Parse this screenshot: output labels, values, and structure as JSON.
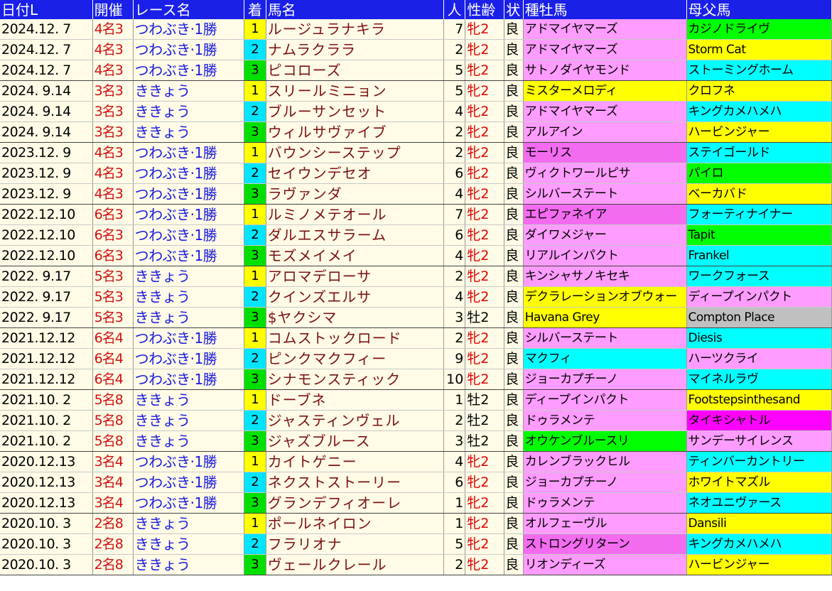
{
  "headers": [
    "日付L",
    "開催",
    "レース名",
    "着",
    "馬名",
    "人",
    "性齢",
    "状",
    "種牡馬",
    "母父馬"
  ],
  "colors": {
    "header_bg": "#1a20e8",
    "cell_bg": "#fffbe6",
    "pos1": "#ffff00",
    "pos2": "#00e5ff",
    "pos3": "#00e000",
    "pink": "#ff9cff",
    "cyan": "#00ffff",
    "yellow": "#ffff00",
    "green": "#00ff00",
    "magenta": "#ff00ff",
    "gray": "#c0c0c0"
  },
  "rows": [
    {
      "date": "2024.12. 7",
      "kai": "4名3",
      "race": "つわぶき·1勝",
      "pos": "1",
      "horse": "ルージュラナキラ",
      "pop": "7",
      "sex": "牝2",
      "cond": "良",
      "sire": "アドマイヤマーズ",
      "sire_color": "pink",
      "bms": "カジノドライヴ",
      "bms_color": "green"
    },
    {
      "date": "2024.12. 7",
      "kai": "4名3",
      "race": "つわぶき·1勝",
      "pos": "2",
      "horse": "ナムラクララ",
      "pop": "2",
      "sex": "牝2",
      "cond": "良",
      "sire": "アドマイヤマーズ",
      "sire_color": "pink",
      "bms": "Storm Cat",
      "bms_color": "yellow"
    },
    {
      "date": "2024.12. 7",
      "kai": "4名3",
      "race": "つわぶき·1勝",
      "pos": "3",
      "horse": "ピコローズ",
      "pop": "5",
      "sex": "牝2",
      "cond": "良",
      "sire": "サトノダイヤモンド",
      "sire_color": "pink",
      "bms": "ストーミングホーム",
      "bms_color": "cyan"
    },
    {
      "date": "2024. 9.14",
      "kai": "3名3",
      "race": "ききょう",
      "pos": "1",
      "horse": "スリールミニョン",
      "pop": "5",
      "sex": "牝2",
      "cond": "良",
      "sire": "ミスターメロディ",
      "sire_color": "yellow",
      "bms": "クロフネ",
      "bms_color": "yellow"
    },
    {
      "date": "2024. 9.14",
      "kai": "3名3",
      "race": "ききょう",
      "pos": "2",
      "horse": "ブルーサンセット",
      "pop": "4",
      "sex": "牝2",
      "cond": "良",
      "sire": "アドマイヤマーズ",
      "sire_color": "pink",
      "bms": "キングカメハメハ",
      "bms_color": "cyan"
    },
    {
      "date": "2024. 9.14",
      "kai": "3名3",
      "race": "ききょう",
      "pos": "3",
      "horse": "ウィルサヴァイブ",
      "pop": "2",
      "sex": "牝2",
      "cond": "良",
      "sire": "アルアイン",
      "sire_color": "pink",
      "bms": "ハービンジャー",
      "bms_color": "yellow"
    },
    {
      "date": "2023.12. 9",
      "kai": "4名3",
      "race": "つわぶき·1勝",
      "pos": "1",
      "horse": "バウンシーステップ",
      "pop": "2",
      "sex": "牝2",
      "cond": "良",
      "sire": "モーリス",
      "sire_color": "magenta_soft",
      "bms": "ステイゴールド",
      "bms_color": "cyan"
    },
    {
      "date": "2023.12. 9",
      "kai": "4名3",
      "race": "つわぶき·1勝",
      "pos": "2",
      "horse": "セイウンデセオ",
      "pop": "6",
      "sex": "牝2",
      "cond": "良",
      "sire": "ヴィクトワールピサ",
      "sire_color": "pink",
      "bms": "パイロ",
      "bms_color": "green"
    },
    {
      "date": "2023.12. 9",
      "kai": "4名3",
      "race": "つわぶき·1勝",
      "pos": "3",
      "horse": "ラヴァンダ",
      "pop": "4",
      "sex": "牝2",
      "cond": "良",
      "sire": "シルバーステート",
      "sire_color": "pink",
      "bms": "ベーカバド",
      "bms_color": "yellow"
    },
    {
      "date": "2022.12.10",
      "kai": "6名3",
      "race": "つわぶき·1勝",
      "pos": "1",
      "horse": "ルミノメテオール",
      "pop": "7",
      "sex": "牝2",
      "cond": "良",
      "sire": "エピファネイア",
      "sire_color": "magenta_soft",
      "bms": "フォーティナイナー",
      "bms_color": "cyan"
    },
    {
      "date": "2022.12.10",
      "kai": "6名3",
      "race": "つわぶき·1勝",
      "pos": "2",
      "horse": "ダルエスサラーム",
      "pop": "6",
      "sex": "牝2",
      "cond": "良",
      "sire": "ダイワメジャー",
      "sire_color": "pink",
      "bms": "Tapit",
      "bms_color": "green"
    },
    {
      "date": "2022.12.10",
      "kai": "6名3",
      "race": "つわぶき·1勝",
      "pos": "3",
      "horse": "モズメイメイ",
      "pop": "4",
      "sex": "牝2",
      "cond": "良",
      "sire": "リアルインパクト",
      "sire_color": "pink",
      "bms": "Frankel",
      "bms_color": "cyan"
    },
    {
      "date": "2022. 9.17",
      "kai": "5名3",
      "race": "ききょう",
      "pos": "1",
      "horse": "アロマデローサ",
      "pop": "2",
      "sex": "牝2",
      "cond": "良",
      "sire": "キンシャサノキセキ",
      "sire_color": "pink",
      "bms": "ワークフォース",
      "bms_color": "cyan"
    },
    {
      "date": "2022. 9.17",
      "kai": "5名3",
      "race": "ききょう",
      "pos": "2",
      "horse": "クインズエルサ",
      "pop": "4",
      "sex": "牝2",
      "cond": "良",
      "sire": "デクラレーションオブウォー",
      "sire_color": "yellow",
      "bms": "ディープインパクト",
      "bms_color": "pink"
    },
    {
      "date": "2022. 9.17",
      "kai": "5名3",
      "race": "ききょう",
      "pos": "3",
      "horse": "$ヤクシマ",
      "pop": "3",
      "sex": "牡2",
      "cond": "良",
      "sire": "Havana Grey",
      "sire_color": "yellow",
      "bms": "Compton Place",
      "bms_color": "gray"
    },
    {
      "date": "2021.12.12",
      "kai": "6名4",
      "race": "つわぶき·1勝",
      "pos": "1",
      "horse": "コムストックロード",
      "pop": "2",
      "sex": "牝2",
      "cond": "良",
      "sire": "シルバーステート",
      "sire_color": "pink",
      "bms": "Diesis",
      "bms_color": "cyan"
    },
    {
      "date": "2021.12.12",
      "kai": "6名4",
      "race": "つわぶき·1勝",
      "pos": "2",
      "horse": "ピンクマクフィー",
      "pop": "9",
      "sex": "牝2",
      "cond": "良",
      "sire": "マクフィ",
      "sire_color": "cyan",
      "bms": "ハーツクライ",
      "bms_color": "pink"
    },
    {
      "date": "2021.12.12",
      "kai": "6名4",
      "race": "つわぶき·1勝",
      "pos": "3",
      "horse": "シナモンスティック",
      "pop": "10",
      "sex": "牝2",
      "cond": "良",
      "sire": "ジョーカプチーノ",
      "sire_color": "pink",
      "bms": "マイネルラヴ",
      "bms_color": "cyan"
    },
    {
      "date": "2021.10. 2",
      "kai": "5名8",
      "race": "ききょう",
      "pos": "1",
      "horse": "ドーブネ",
      "pop": "1",
      "sex": "牡2",
      "cond": "良",
      "sire": "ディープインパクト",
      "sire_color": "pink",
      "bms": "Footstepsinthesand",
      "bms_color": "yellow"
    },
    {
      "date": "2021.10. 2",
      "kai": "5名8",
      "race": "ききょう",
      "pos": "2",
      "horse": "ジャスティンヴェル",
      "pop": "2",
      "sex": "牡2",
      "cond": "良",
      "sire": "ドゥラメンテ",
      "sire_color": "pink",
      "bms": "タイキシャトル",
      "bms_color": "magenta"
    },
    {
      "date": "2021.10. 2",
      "kai": "5名8",
      "race": "ききょう",
      "pos": "3",
      "horse": "ジャズブルース",
      "pop": "3",
      "sex": "牡2",
      "cond": "良",
      "sire": "オウケンブルースリ",
      "sire_color": "green",
      "bms": "サンデーサイレンス",
      "bms_color": "pink"
    },
    {
      "date": "2020.12.13",
      "kai": "3名4",
      "race": "つわぶき·1勝",
      "pos": "1",
      "horse": "カイトゲニー",
      "pop": "4",
      "sex": "牝2",
      "cond": "良",
      "sire": "カレンブラックヒル",
      "sire_color": "pink",
      "bms": "ティンバーカントリー",
      "bms_color": "cyan"
    },
    {
      "date": "2020.12.13",
      "kai": "3名4",
      "race": "つわぶき·1勝",
      "pos": "2",
      "horse": "ネクストストーリー",
      "pop": "6",
      "sex": "牝2",
      "cond": "良",
      "sire": "ジョーカプチーノ",
      "sire_color": "pink",
      "bms": "ホワイトマズル",
      "bms_color": "yellow"
    },
    {
      "date": "2020.12.13",
      "kai": "3名4",
      "race": "つわぶき·1勝",
      "pos": "3",
      "horse": "グランデフィオーレ",
      "pop": "1",
      "sex": "牝2",
      "cond": "良",
      "sire": "ドゥラメンテ",
      "sire_color": "pink",
      "bms": "ネオユニヴァース",
      "bms_color": "cyan"
    },
    {
      "date": "2020.10. 3",
      "kai": "2名8",
      "race": "ききょう",
      "pos": "1",
      "horse": "ポールネイロン",
      "pop": "1",
      "sex": "牝2",
      "cond": "良",
      "sire": "オルフェーヴル",
      "sire_color": "pink",
      "bms": "Dansili",
      "bms_color": "yellow"
    },
    {
      "date": "2020.10. 3",
      "kai": "2名8",
      "race": "ききょう",
      "pos": "2",
      "horse": "フラリオナ",
      "pop": "5",
      "sex": "牝2",
      "cond": "良",
      "sire": "ストロングリターン",
      "sire_color": "magenta_soft",
      "bms": "キングカメハメハ",
      "bms_color": "cyan"
    },
    {
      "date": "2020.10. 3",
      "kai": "2名8",
      "race": "ききょう",
      "pos": "3",
      "horse": "ヴェールクレール",
      "pop": "2",
      "sex": "牝2",
      "cond": "良",
      "sire": "リオンディーズ",
      "sire_color": "pink",
      "bms": "ハービンジャー",
      "bms_color": "yellow"
    }
  ]
}
